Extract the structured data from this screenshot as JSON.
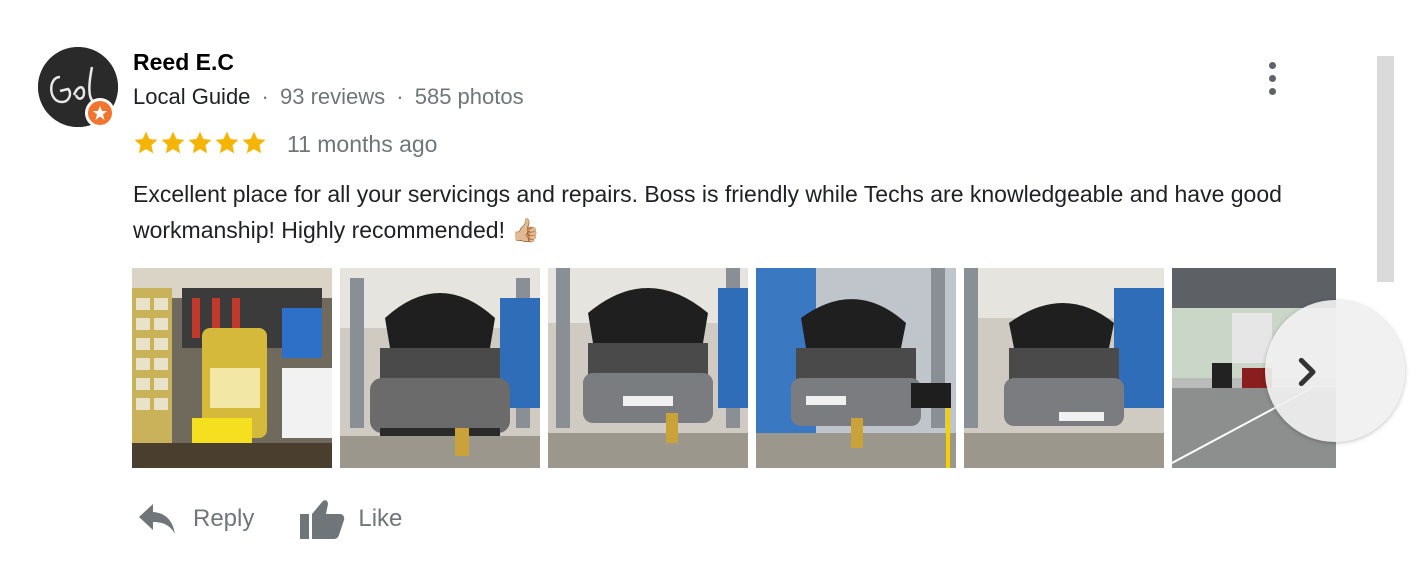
{
  "review": {
    "author_name": "Reed E.C",
    "author_badge": "Local Guide",
    "reviews_count": "93 reviews",
    "photos_count": "585 photos",
    "separator": "·",
    "rating": 5,
    "max_rating": 5,
    "time_ago": "11 months ago",
    "text": "Excellent place for all your servicings and repairs. Boss is friendly while Techs are knowledgeable and have good workmanship! Highly recommended! 👍🏼",
    "photo_count_shown": 6
  },
  "actions": {
    "reply_label": "Reply",
    "like_label": "Like"
  },
  "colors": {
    "star": "#f4b400",
    "muted_text": "#70757a",
    "badge": "#f1742f"
  },
  "icons": {
    "more": "more-vert-icon",
    "reply": "reply-arrow-icon",
    "like": "thumb-up-icon",
    "next": "chevron-right-icon"
  }
}
